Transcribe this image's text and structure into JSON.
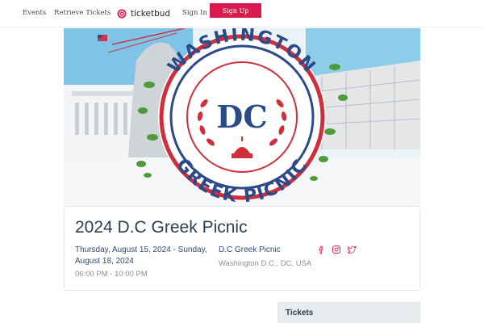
{
  "nav": {
    "events": "Events",
    "retrieve_tickets": "Retrieve Tickets",
    "brand": "ticketbud",
    "sign_in": "Sign In",
    "sign_up": "Sign Up"
  },
  "banner": {
    "top_text": "WASHINGTON",
    "center_text": "DC",
    "bottom_text": "GREEK PICNIC"
  },
  "event": {
    "title": "2024 D.C Greek Picnic",
    "dates": "Thursday, August 15, 2024 - Sunday, August 18, 2024",
    "time": "06:00 PM - 10:00 PM",
    "venue": "D.C Greek Picnic",
    "location": "Washington D.C., DC, USA"
  },
  "social": {
    "icons": [
      "facebook-icon",
      "instagram-icon",
      "twitter-icon"
    ]
  },
  "tickets": {
    "label": "Tickets"
  },
  "colors": {
    "brand_accent": "#d81b4c",
    "heading": "#2c3e50",
    "link_blue": "#2f4a73",
    "muted": "#8b8f95",
    "logo_red": "#cf2e3a",
    "logo_navy": "#2b4a8a"
  }
}
